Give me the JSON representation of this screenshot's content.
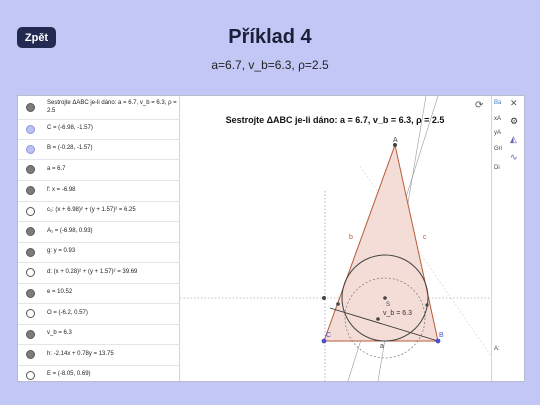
{
  "header": {
    "back_label": "Zpět",
    "title": "Příklad 4",
    "subtitle": "a=6.7, v_b=6.3, ρ=2.5"
  },
  "algebra": {
    "rows": [
      {
        "text": "Sestrojte ΔABC je-li dáno: a = 6.7, v_b = 6.3, ρ = 2.5",
        "dot": "on-gray"
      },
      {
        "text": "C = (-6.98, -1.57)",
        "dot": "on-blue"
      },
      {
        "text": "B = (-0.28, -1.57)",
        "dot": "on-blue"
      },
      {
        "text": "a = 6.7",
        "dot": "on-gray"
      },
      {
        "text": "f: x = -6.98",
        "dot": "on-gray"
      },
      {
        "text": "c₁: (x + 6.98)² + (y + 1.57)² = 6.25",
        "dot": "off"
      },
      {
        "text": "A₁ = (-6.98, 0.93)",
        "dot": "on-gray"
      },
      {
        "text": "g: y = 0.93",
        "dot": "on-gray"
      },
      {
        "text": "d: (x + 0.28)² + (y + 1.57)² = 39.69",
        "dot": "off"
      },
      {
        "text": "e = 10.52",
        "dot": "on-gray"
      },
      {
        "text": "O = (-6.2, 0.57)",
        "dot": "off"
      },
      {
        "text": "v_b = 6.3",
        "dot": "on-gray"
      },
      {
        "text": "h: -2.14x + 0.78y = 13.75",
        "dot": "on-gray"
      },
      {
        "text": "E = (-8.05, 0.69)",
        "dot": "off"
      }
    ]
  },
  "graphics": {
    "title": "Sestrojte ΔABC je-li dáno: a = 6.7, v_b = 6.3, ρ = 2.5",
    "labels": {
      "A": "A",
      "B": "B",
      "C": "C",
      "a": "a",
      "b": "b",
      "c": "c",
      "vb": "v_b = 6.3",
      "s": "S"
    },
    "colors": {
      "triangle_fill": "#f3ddd6",
      "triangle_edge": "#b85a3a",
      "point_blue": "#4a52c8",
      "circle": "#444444"
    }
  },
  "sidepanel": {
    "items": [
      "Ba",
      "xA",
      "yA",
      "Gri",
      "Di",
      "A:"
    ]
  },
  "icons": {
    "refresh": "refresh-icon",
    "close": "close-icon",
    "gear": "gear-icon",
    "style": "style-icon",
    "function": "function-icon"
  }
}
